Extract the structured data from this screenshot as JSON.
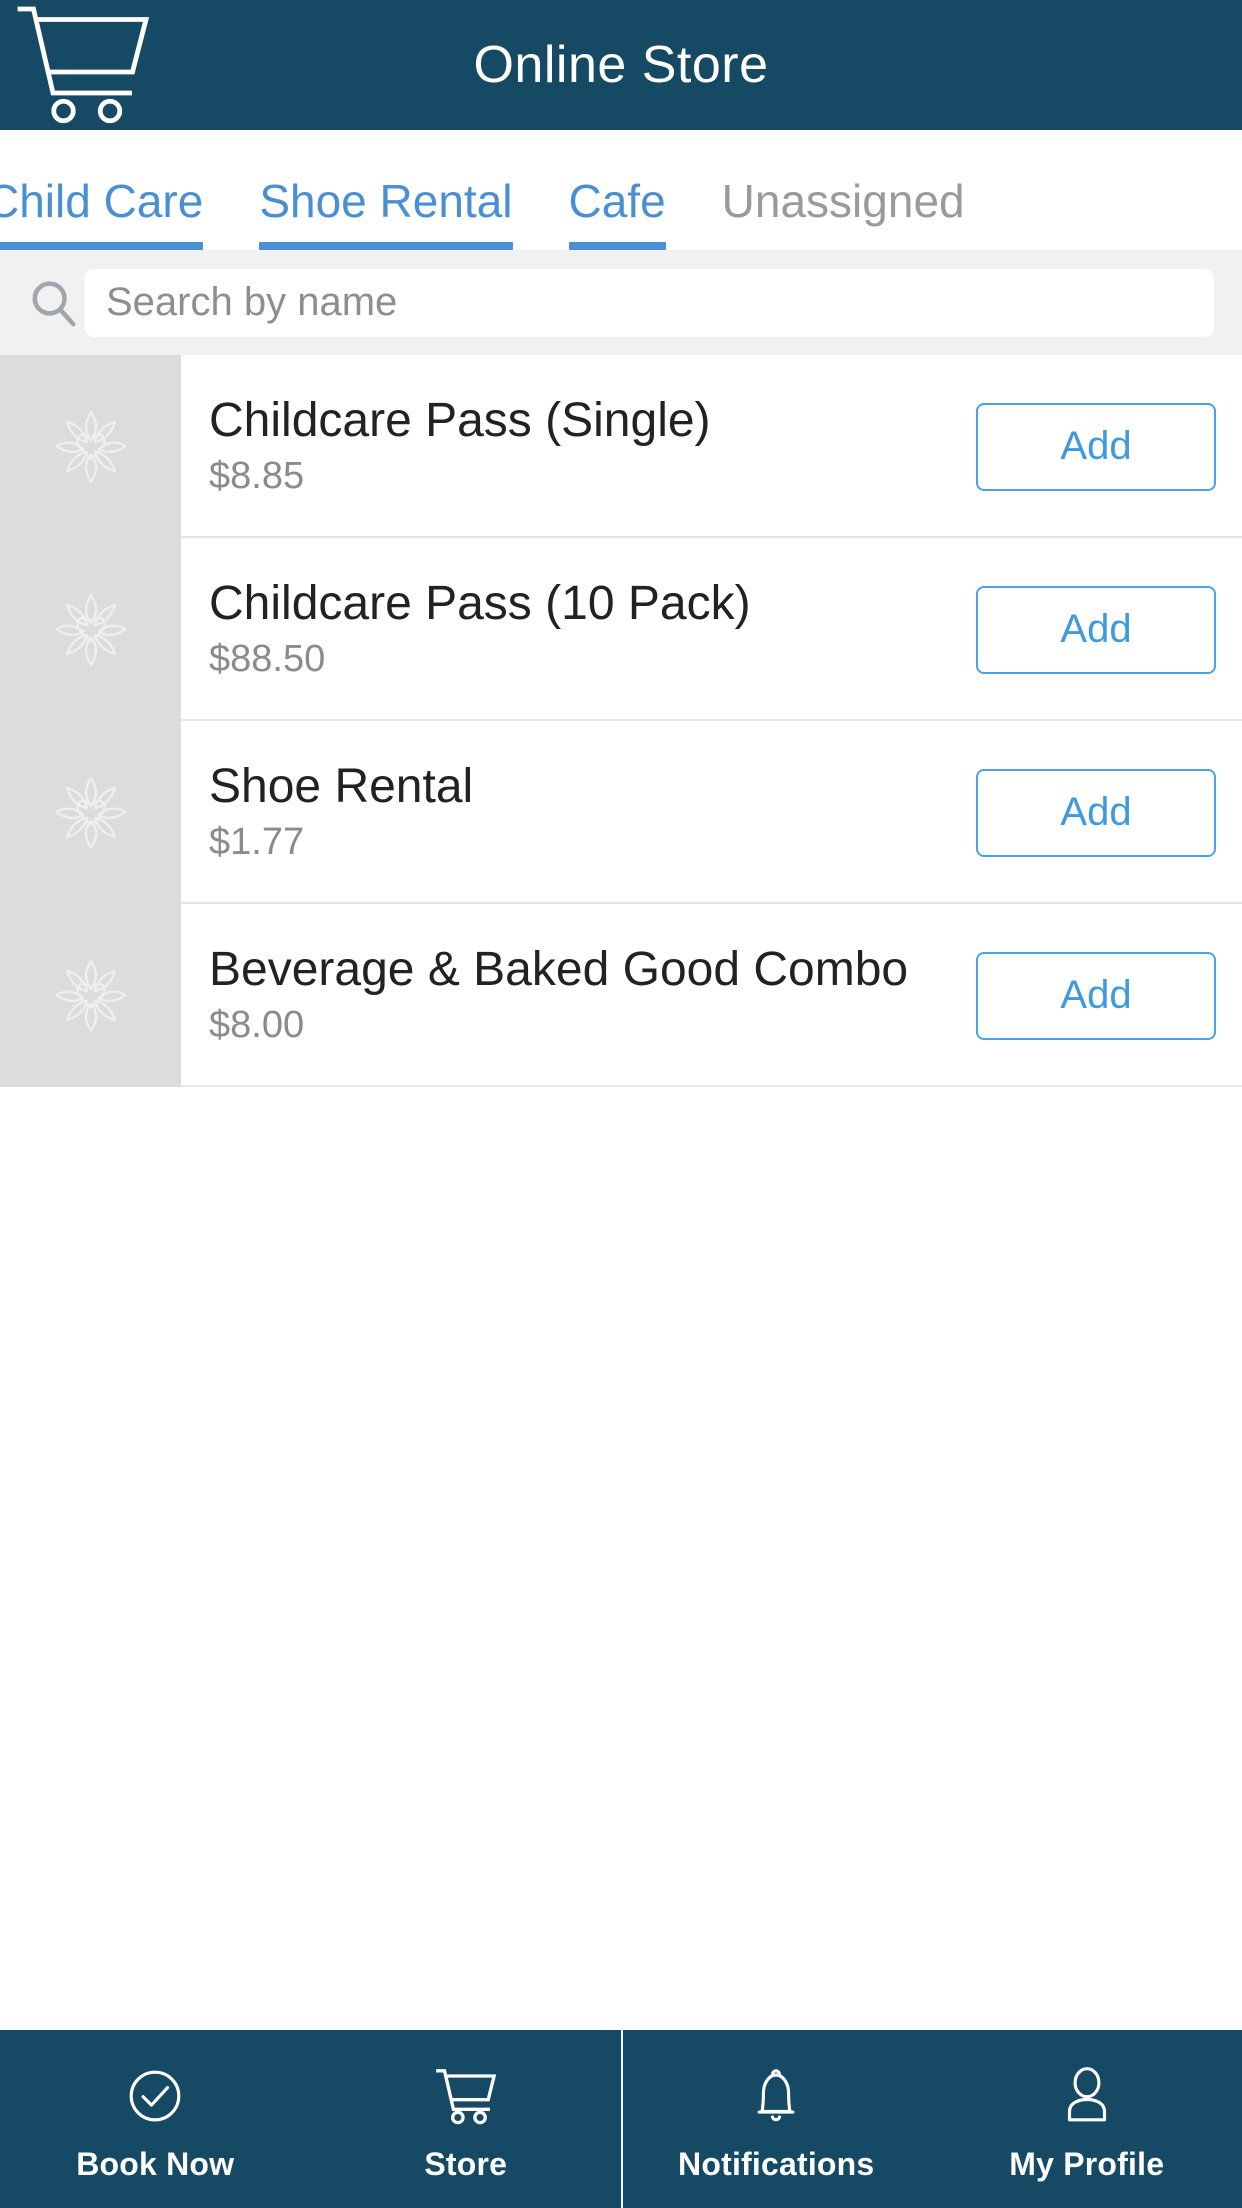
{
  "header": {
    "title": "Online Store",
    "cart_icon": "shopping-cart-icon",
    "background_color": "#164963"
  },
  "tabs": {
    "accent_color": "#4a8fd4",
    "inactive_color": "#9a9a9a",
    "items": [
      {
        "label": "Child Care",
        "active": true,
        "clipped_left": true
      },
      {
        "label": "Shoe Rental",
        "active": true,
        "clipped_left": false
      },
      {
        "label": "Cafe",
        "active": true,
        "clipped_left": false
      },
      {
        "label": "Unassigned",
        "active": false,
        "clipped_left": false
      }
    ]
  },
  "search": {
    "placeholder": "Search by name",
    "value": "",
    "icon": "search-icon"
  },
  "products": {
    "add_label": "Add",
    "placeholder_icon": "flower-heart-placeholder-icon",
    "items": [
      {
        "name": "Childcare Pass (Single)",
        "price": "$8.85"
      },
      {
        "name": "Childcare Pass (10 Pack)",
        "price": "$88.50"
      },
      {
        "name": "Shoe Rental",
        "price": "$1.77"
      },
      {
        "name": "Beverage & Baked Good Combo",
        "price": "$8.00"
      }
    ]
  },
  "bottom_nav": {
    "items": [
      {
        "label": "Book Now",
        "icon": "check-circle-icon"
      },
      {
        "label": "Store",
        "icon": "shopping-cart-icon"
      },
      {
        "label": "Notifications",
        "icon": "bell-icon"
      },
      {
        "label": "My Profile",
        "icon": "person-icon"
      }
    ]
  }
}
